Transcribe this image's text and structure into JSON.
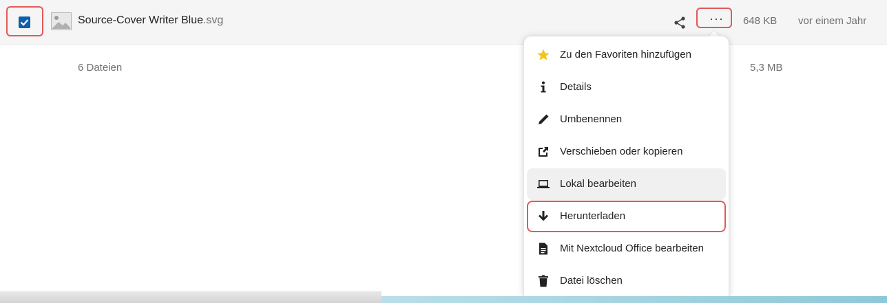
{
  "file": {
    "name": "Source-Cover Writer Blue",
    "extension": ".svg",
    "size": "648 KB",
    "modified": "vor einem Jahr",
    "selected": true
  },
  "summary": {
    "count": "6 Dateien",
    "size": "5,3 MB"
  },
  "icons": {
    "checkbox": "checkmark-icon",
    "thumbnail": "image-icon",
    "share": "share-icon",
    "more": "more-dots-icon"
  },
  "menu": {
    "items": [
      {
        "label": "Zu den Favoriten hinzufügen",
        "icon": "star-icon"
      },
      {
        "label": "Details",
        "icon": "info-icon"
      },
      {
        "label": "Umbenennen",
        "icon": "pencil-icon"
      },
      {
        "label": "Verschieben oder kopieren",
        "icon": "move-icon"
      },
      {
        "label": "Lokal bearbeiten",
        "icon": "laptop-icon"
      },
      {
        "label": "Herunterladen",
        "icon": "download-icon"
      },
      {
        "label": "Mit Nextcloud Office bearbeiten",
        "icon": "document-icon"
      },
      {
        "label": "Datei löschen",
        "icon": "trash-icon"
      }
    ]
  },
  "colors": {
    "accent": "#0f5ea8",
    "highlight": "#e05a5a",
    "star": "#f5c518"
  }
}
